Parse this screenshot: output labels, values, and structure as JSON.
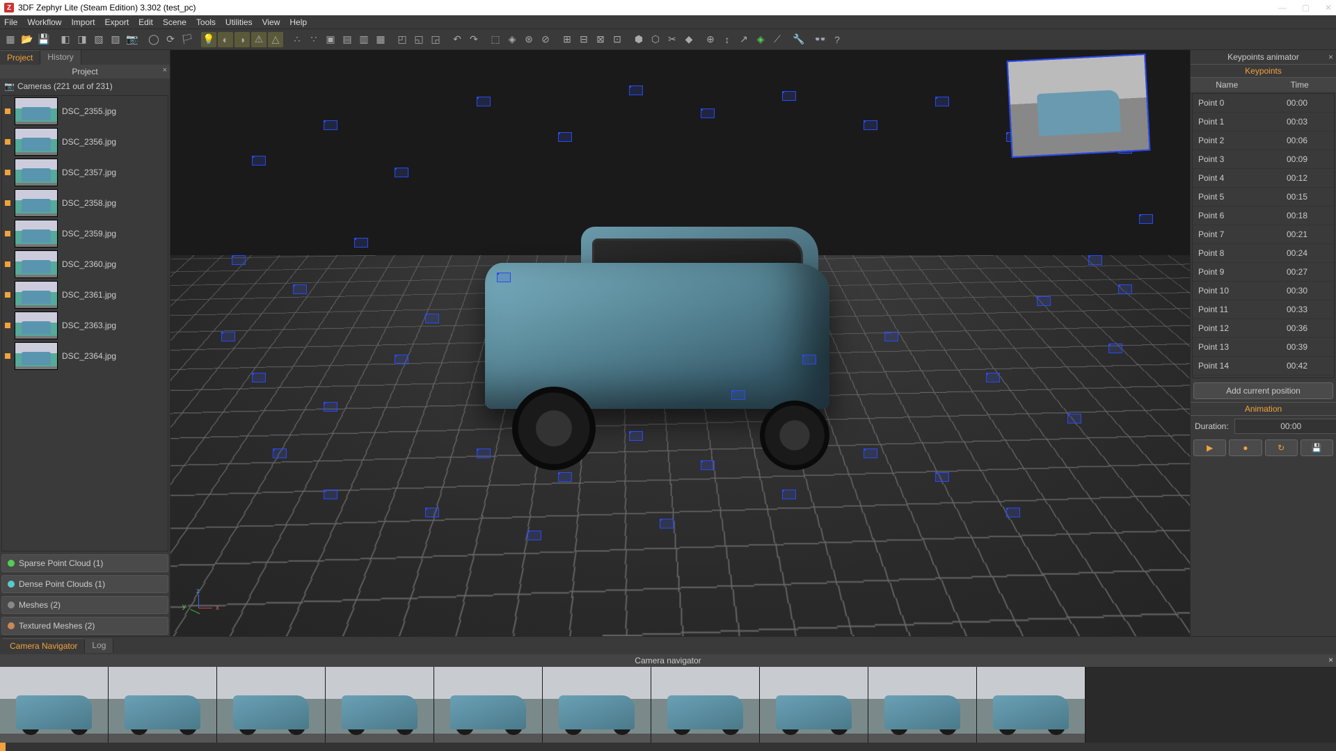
{
  "window": {
    "title": "3DF Zephyr Lite (Steam Edition) 3.302 (test_pc)"
  },
  "menu": [
    "File",
    "Workflow",
    "Import",
    "Export",
    "Edit",
    "Scene",
    "Tools",
    "Utilities",
    "View",
    "Help"
  ],
  "left_tabs": {
    "project": "Project",
    "history": "History",
    "panel_label": "Project"
  },
  "cameras_header": "Cameras (221 out of 231)",
  "camera_items": [
    "DSC_2355.jpg",
    "DSC_2356.jpg",
    "DSC_2357.jpg",
    "DSC_2358.jpg",
    "DSC_2359.jpg",
    "DSC_2360.jpg",
    "DSC_2361.jpg",
    "DSC_2363.jpg",
    "DSC_2364.jpg"
  ],
  "sections": {
    "sparse": "Sparse Point Cloud (1)",
    "dense": "Dense Point Clouds (1)",
    "meshes": "Meshes (2)",
    "textured": "Textured Meshes (2)"
  },
  "bottom_tabs": {
    "camnav": "Camera Navigator",
    "log": "Log",
    "panel_label": "Camera navigator"
  },
  "right": {
    "title": "Keypoints animator",
    "keypoints_label": "Keypoints",
    "col_name": "Name",
    "col_time": "Time",
    "points": [
      {
        "n": "Point 0",
        "t": "00:00"
      },
      {
        "n": "Point 1",
        "t": "00:03"
      },
      {
        "n": "Point 2",
        "t": "00:06"
      },
      {
        "n": "Point 3",
        "t": "00:09"
      },
      {
        "n": "Point 4",
        "t": "00:12"
      },
      {
        "n": "Point 5",
        "t": "00:15"
      },
      {
        "n": "Point 6",
        "t": "00:18"
      },
      {
        "n": "Point 7",
        "t": "00:21"
      },
      {
        "n": "Point 8",
        "t": "00:24"
      },
      {
        "n": "Point 9",
        "t": "00:27"
      },
      {
        "n": "Point 10",
        "t": "00:30"
      },
      {
        "n": "Point 11",
        "t": "00:33"
      },
      {
        "n": "Point 12",
        "t": "00:36"
      },
      {
        "n": "Point 13",
        "t": "00:39"
      },
      {
        "n": "Point 14",
        "t": "00:42"
      }
    ],
    "add_btn": "Add current position",
    "animation_label": "Animation",
    "duration_label": "Duration:",
    "duration_value": "00:00"
  },
  "colors": {
    "accent": "#f2a23c",
    "camera_wire": "#2a4af0"
  }
}
